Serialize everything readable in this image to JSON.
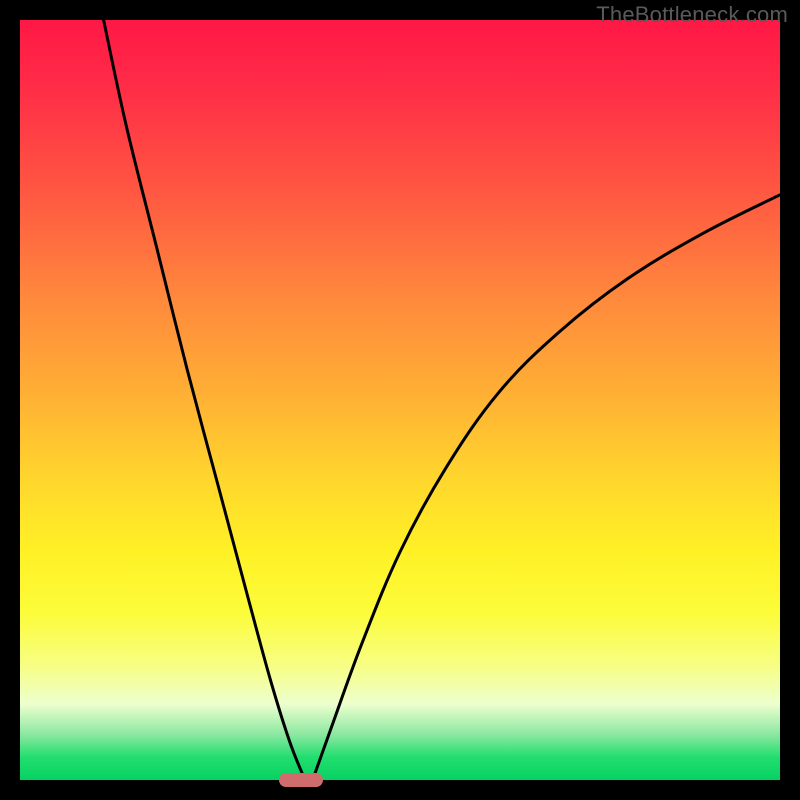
{
  "watermark": "TheBottleneck.com",
  "chart_data": {
    "type": "line",
    "title": "",
    "xlabel": "",
    "ylabel": "",
    "xlim": [
      0,
      100
    ],
    "ylim": [
      0,
      100
    ],
    "grid": false,
    "legend": false,
    "background_gradient": {
      "stops": [
        {
          "pos": 0,
          "color": "#ff1846"
        },
        {
          "pos": 0.5,
          "color": "#ffb234"
        },
        {
          "pos": 0.78,
          "color": "#fcfc3a"
        },
        {
          "pos": 1.0,
          "color": "#06d262"
        }
      ],
      "semantic": "top red = poor, bottom green = ideal"
    },
    "marker": {
      "x": 37,
      "y": 0,
      "color": "#cf6d6d",
      "shape": "pill"
    },
    "series": [
      {
        "name": "left-branch",
        "color": "#000000",
        "x": [
          11,
          14,
          18,
          22,
          26,
          30,
          33,
          35.5,
          37.5
        ],
        "y": [
          100,
          86,
          70,
          54,
          39,
          24,
          13,
          5,
          0
        ]
      },
      {
        "name": "right-branch",
        "color": "#000000",
        "x": [
          38.5,
          41,
          45,
          50,
          56,
          63,
          71,
          80,
          90,
          100
        ],
        "y": [
          0,
          7,
          18,
          30,
          41,
          51,
          59,
          66,
          72,
          77
        ]
      }
    ],
    "notes": "Bottleneck-style V-curve; minimum (green zone) at x≈37. Values estimated from pixel positions relative to 760×760 plot interior."
  }
}
